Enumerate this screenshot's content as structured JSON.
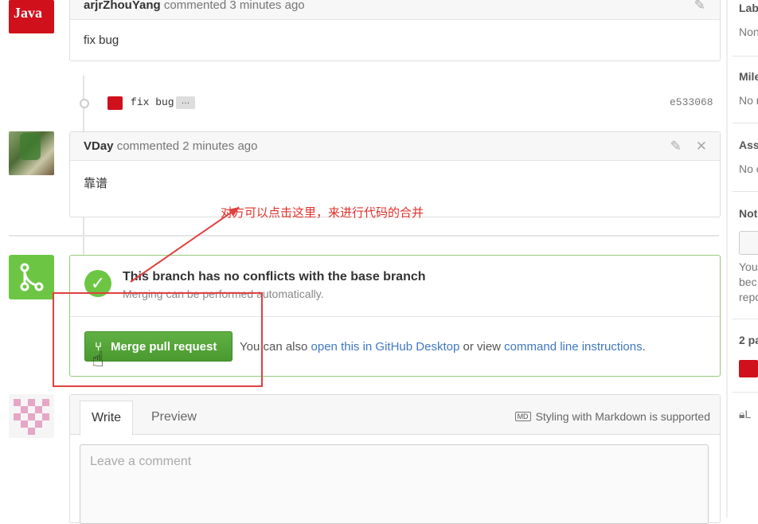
{
  "comments": [
    {
      "author": "arjrZhouYang",
      "meta": "commented 3 minutes ago",
      "body": "fix bug"
    },
    {
      "author": "VDay",
      "meta": "commented 2 minutes ago",
      "body": "靠谱"
    }
  ],
  "commit": {
    "message": "fix bug",
    "ellipsis": "…",
    "sha": "e533068"
  },
  "merge": {
    "title": "This branch has no conflicts with the base branch",
    "subtitle": "Merging can be performed automatically.",
    "button_label": "Merge pull request",
    "alt_prefix": "You can also ",
    "alt_link1": "open this in GitHub Desktop",
    "alt_middle": " or view ",
    "alt_link2": "command line instructions",
    "alt_suffix": "."
  },
  "annotation": {
    "text": "对方可以点击这里，来进行代码的合并"
  },
  "editor": {
    "tab_write": "Write",
    "tab_preview": "Preview",
    "markdown_note": "Styling with Markdown is supported",
    "markdown_badge": "MD",
    "placeholder": "Leave a comment"
  },
  "sidebar": {
    "labels_h": "Lab",
    "labels_v": "Non",
    "milestone_h": "Mile",
    "milestone_v": "No m",
    "assignee_h": "Ass",
    "assignee_v": "No o",
    "notif_h": "Not",
    "notif_t1": "You",
    "notif_t2": "bec",
    "notif_t3": "repo",
    "participants_h": "2 pa",
    "lock_t": "L"
  },
  "icons": {
    "edit": "pencil-icon",
    "close": "close-icon",
    "merge": "git-merge-icon",
    "check": "check-icon",
    "lock": "lock-icon"
  },
  "colors": {
    "merge_green": "#6cc644",
    "link_blue": "#4078c0",
    "annotation_red": "#e0302a"
  }
}
